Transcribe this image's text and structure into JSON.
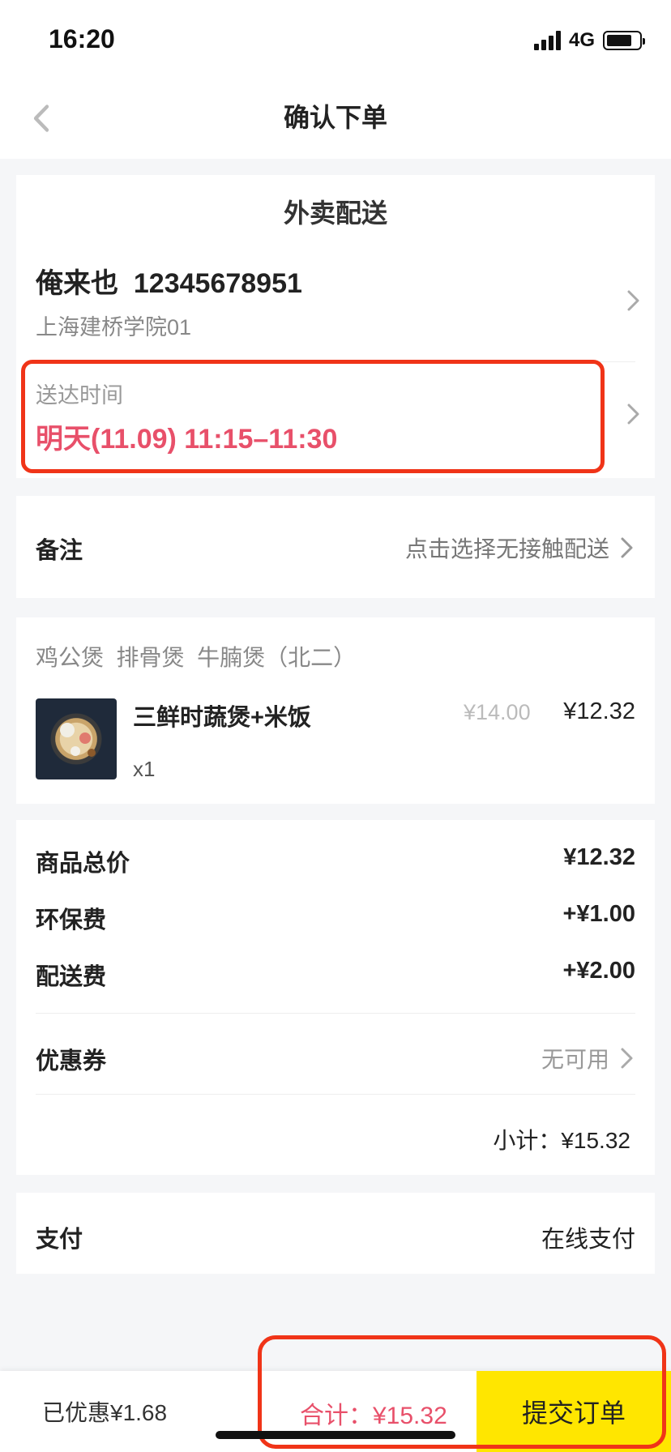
{
  "status_bar": {
    "time": "16:20",
    "network": "4G"
  },
  "header": {
    "title": "确认下单"
  },
  "delivery": {
    "section_title": "外卖配送",
    "contact": "俺来也  12345678951",
    "address": "上海建桥学院01",
    "time_label": "送达时间",
    "time_value": "明天(11.09) 11:15–11:30"
  },
  "remark": {
    "label": "备注",
    "action": "点击选择无接触配送"
  },
  "order": {
    "shop_name": "鸡公煲  排骨煲  牛腩煲（北二）",
    "items": [
      {
        "name": "三鲜时蔬煲+米饭",
        "original_price": "¥14.00",
        "price": "¥12.32",
        "quantity": "x1"
      }
    ]
  },
  "summary": {
    "goods_total_label": "商品总价",
    "goods_total_value": "¥12.32",
    "eco_fee_label": "环保费",
    "eco_fee_value": "+¥1.00",
    "delivery_fee_label": "配送费",
    "delivery_fee_value": "+¥2.00",
    "coupon_label": "优惠券",
    "coupon_value": "无可用",
    "subtotal": "小计：¥15.32"
  },
  "payment": {
    "label": "支付",
    "value": "在线支付"
  },
  "footer": {
    "discount": "已优惠¥1.68",
    "total": "合计：¥15.32",
    "submit_label": "提交订单"
  },
  "colors": {
    "accent_red": "#e8506a",
    "submit_yellow": "#ffe600",
    "annotation_red": "#f03418"
  },
  "icons": [
    "back-arrow-icon",
    "chevron-right-icon",
    "signal-icon",
    "battery-icon"
  ]
}
